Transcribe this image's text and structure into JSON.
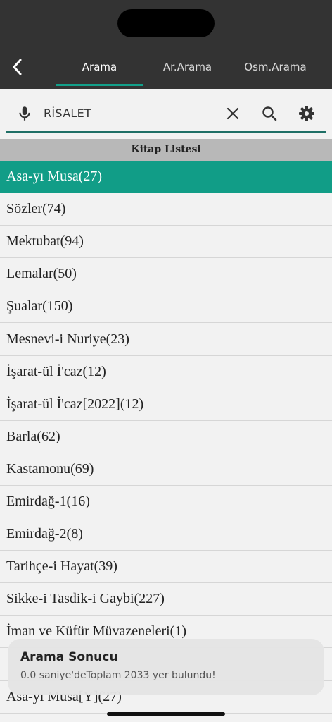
{
  "header": {
    "tabs": [
      {
        "label": "Arama",
        "active": true
      },
      {
        "label": "Ar.Arama",
        "active": false
      },
      {
        "label": "Osm.Arama",
        "active": false
      }
    ],
    "back_icon": "chevron-left-icon"
  },
  "search": {
    "value": "RİSALET",
    "mic_icon": "microphone-icon",
    "clear_icon": "close-icon",
    "search_icon": "search-icon",
    "settings_icon": "gear-icon"
  },
  "list": {
    "header": "Kitap Listesi",
    "items": [
      "Asa-yı Musa(27)",
      "Sözler(74)",
      "Mektubat(94)",
      "Lemalar(50)",
      "Şualar(150)",
      "Mesnevi-i Nuriye(23)",
      "İşarat-ül İ'caz(12)",
      "İşarat-ül İ'caz[2022](12)",
      "Barla(62)",
      "Kastamonu(69)",
      "Emirdağ-1(16)",
      "Emirdağ-2(8)",
      "Tarihçe-i Hayat(39)",
      "Sikke-i Tasdik-i Gaybi(227)",
      "İman ve Küfür Müvazeneleri(1)",
      "",
      "Asa-yı Musa[Y](27)"
    ],
    "selected_index": 0
  },
  "toast": {
    "title": "Arama Sonucu",
    "message": "0.0 saniye'deToplam 2033 yer bulundu!"
  },
  "colors": {
    "accent": "#119d87",
    "topbar": "#333333",
    "background": "#f2f2f2"
  }
}
